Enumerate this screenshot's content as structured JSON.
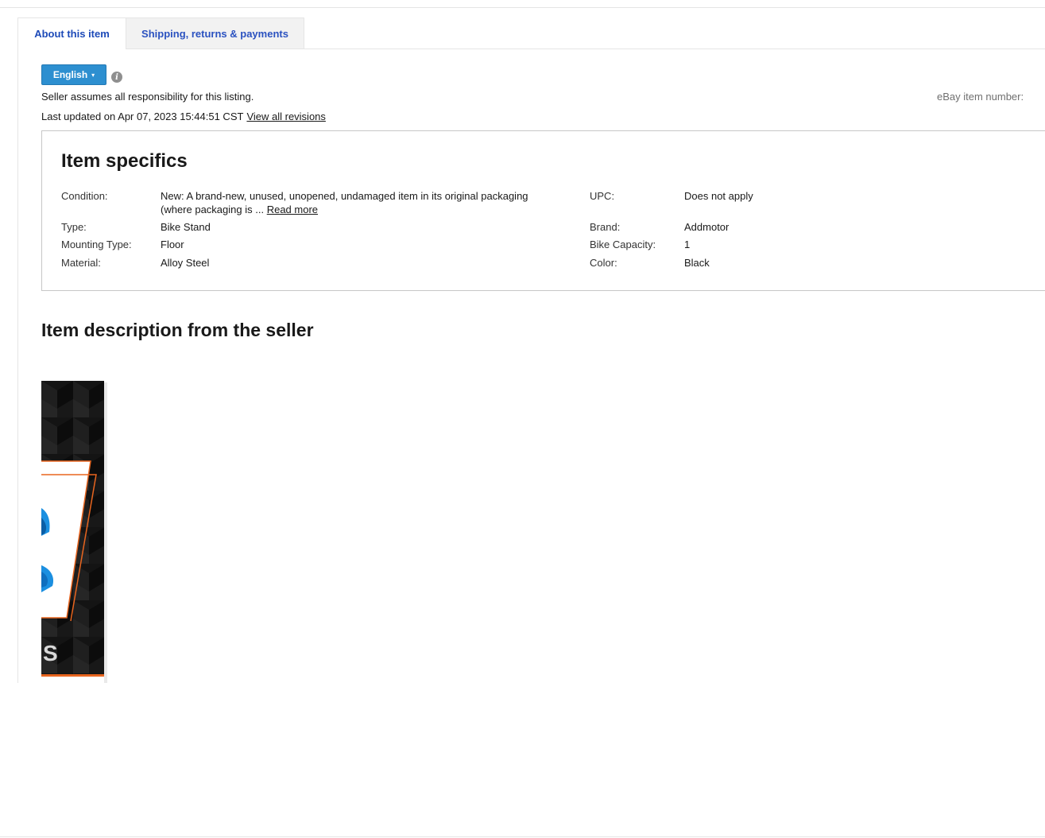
{
  "tabs": [
    {
      "label": "About this item",
      "active": true
    },
    {
      "label": "Shipping, returns & payments",
      "active": false
    }
  ],
  "language": {
    "label": "English",
    "caret": "▾",
    "info_icon": "info-icon"
  },
  "responsibility_text": "Seller assumes all responsibility for this listing.",
  "item_number_label": "eBay item number:",
  "last_updated": {
    "prefix": "Last updated on",
    "date": "Apr 07, 2023 15:44:51 CST",
    "link": "View all revisions"
  },
  "item_specifics": {
    "title": "Item specifics",
    "rows": [
      {
        "label": "Condition:",
        "value_line1": "New: A brand-new, unused, unopened, undamaged item in its original packaging",
        "value_line2": "(where packaging is ...",
        "read_more": "Read more"
      },
      {
        "label": "UPC:",
        "value": "Does not apply"
      },
      {
        "label": "Type:",
        "value": "Bike Stand"
      },
      {
        "label": "Brand:",
        "value": "Addmotor"
      },
      {
        "label": "Mounting Type:",
        "value": "Floor"
      },
      {
        "label": "Bike Capacity:",
        "value": "1"
      },
      {
        "label": "Material:",
        "value": "Alloy Steel"
      },
      {
        "label": "Color:",
        "value": "Black"
      }
    ]
  },
  "description_title": "Item description from the seller",
  "colors": {
    "link_blue": "#3665f3",
    "button_blue": "#2d8fd0",
    "accent_orange": "#e8651f"
  }
}
